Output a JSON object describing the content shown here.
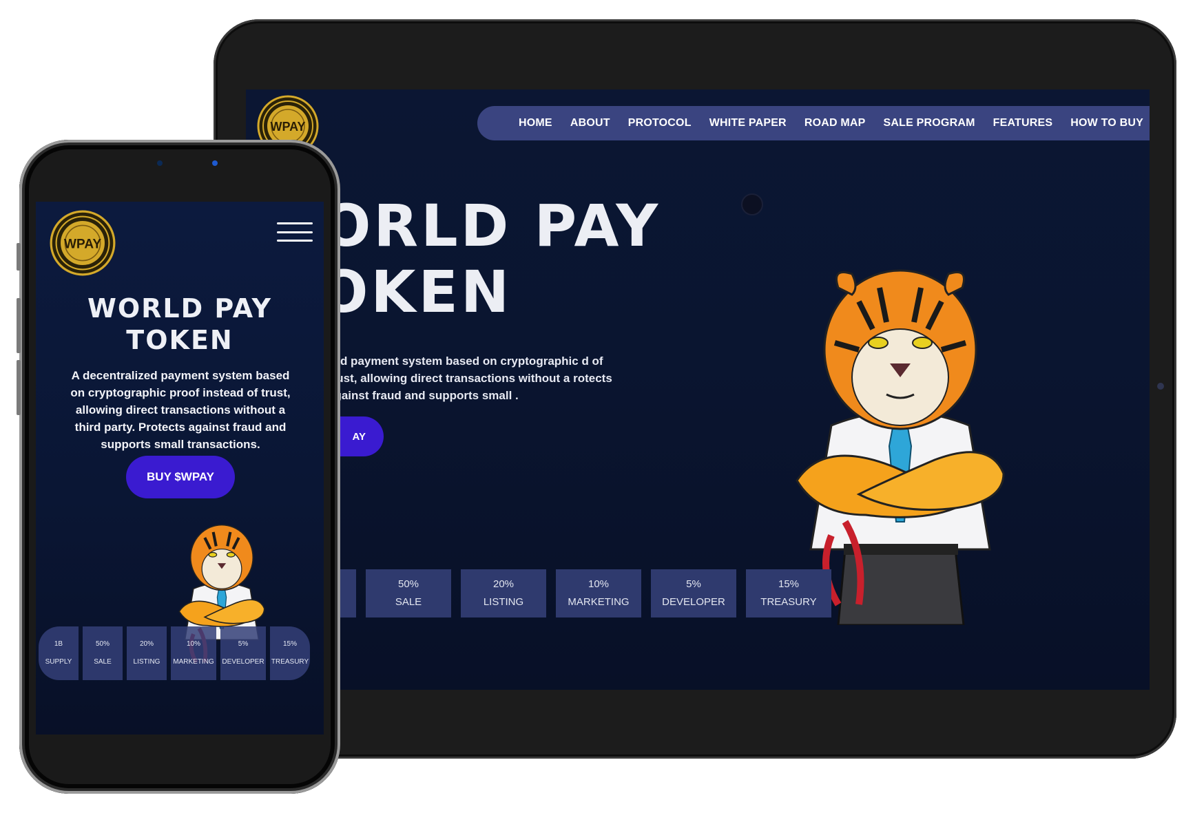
{
  "tablet": {
    "nav": [
      "HOME",
      "ABOUT",
      "PROTOCOL",
      "WHITE PAPER",
      "ROAD MAP",
      "SALE PROGRAM",
      "FEATURES",
      "HOW TO BUY"
    ],
    "logo_text": "WPAY",
    "title_line1": "ORLD PAY",
    "title_line2": "OKEN",
    "description": "zed payment system based on cryptographic d of trust, allowing direct transactions without a rotects against fraud and supports small .",
    "button": "AY",
    "stats": [
      {
        "value": "",
        "label": ""
      },
      {
        "value": "50%",
        "label": "SALE"
      },
      {
        "value": "20%",
        "label": "LISTING"
      },
      {
        "value": "10%",
        "label": "MARKETING"
      },
      {
        "value": "5%",
        "label": "DEVELOPER"
      },
      {
        "value": "15%",
        "label": "TREASURY"
      }
    ]
  },
  "phone": {
    "logo_text": "WPAY",
    "title_line1": "WORLD PAY",
    "title_line2": "TOKEN",
    "description": "A decentralized payment system based on cryptographic proof instead of trust, allowing direct transactions without a third party. Protects against fraud and supports small transactions.",
    "button": "BUY $WPAY",
    "stats": [
      {
        "value": "1B",
        "label": "SUPPLY"
      },
      {
        "value": "50%",
        "label": "SALE"
      },
      {
        "value": "20%",
        "label": "LISTING"
      },
      {
        "value": "10%",
        "label": "MARKETING"
      },
      {
        "value": "5%",
        "label": "DEVELOPER"
      },
      {
        "value": "15%",
        "label": "TREASURY"
      }
    ]
  },
  "colors": {
    "background": "#0a1530",
    "nav_bar": "#3a4480",
    "button": "#3a1bd0",
    "stat_box": "#2f3a6e",
    "logo_gold": "#d4a92a"
  },
  "icons": [
    "wpay-logo-icon",
    "tiger-mascot-icon",
    "hamburger-menu-icon"
  ]
}
